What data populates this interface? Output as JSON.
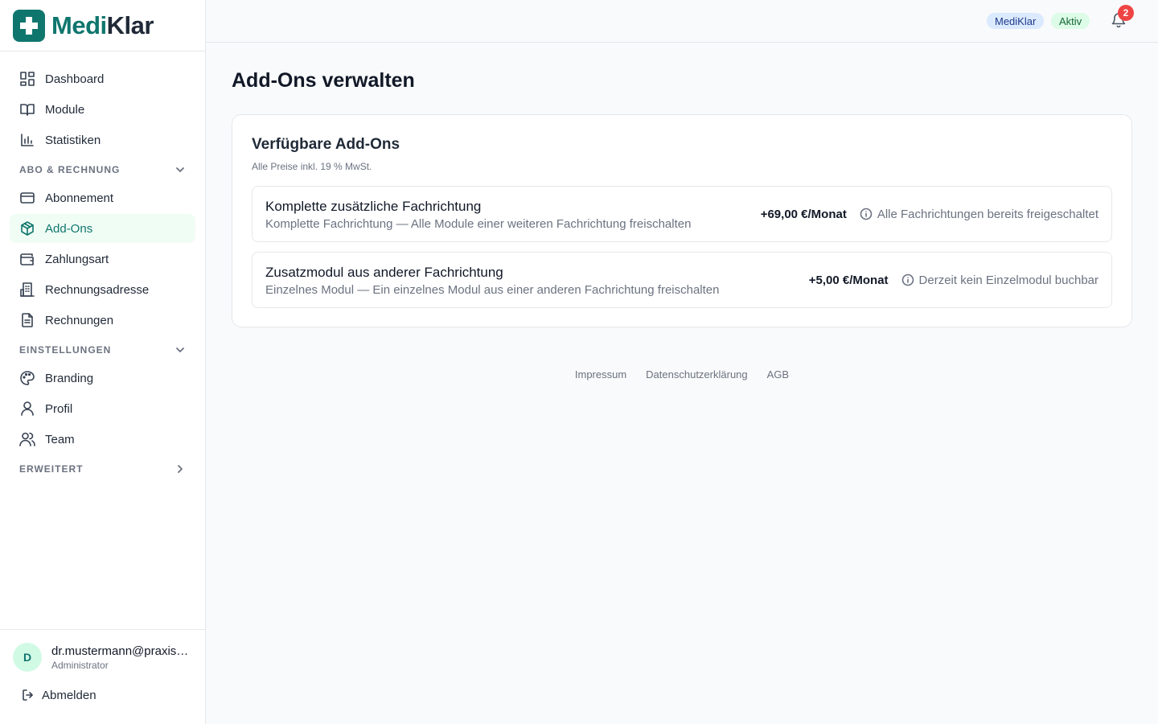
{
  "brand": {
    "name_part1": "Medi",
    "name_part2": "Klar",
    "primary_color": "#0f766e"
  },
  "sidebar": {
    "items": [
      {
        "label": "Dashboard",
        "icon": "dashboard-icon"
      },
      {
        "label": "Module",
        "icon": "book-icon"
      },
      {
        "label": "Statistiken",
        "icon": "bar-chart-icon"
      }
    ],
    "sections": [
      {
        "label": "ABO & RECHNUNG",
        "expanded": true,
        "items": [
          {
            "label": "Abonnement",
            "icon": "credit-card-icon"
          },
          {
            "label": "Add-Ons",
            "icon": "package-icon",
            "active": true
          },
          {
            "label": "Zahlungsart",
            "icon": "wallet-icon"
          },
          {
            "label": "Rechnungsadresse",
            "icon": "building-icon"
          },
          {
            "label": "Rechnungen",
            "icon": "document-icon"
          }
        ]
      },
      {
        "label": "EINSTELLUNGEN",
        "expanded": true,
        "items": [
          {
            "label": "Branding",
            "icon": "palette-icon"
          },
          {
            "label": "Profil",
            "icon": "user-icon"
          },
          {
            "label": "Team",
            "icon": "users-icon"
          }
        ]
      },
      {
        "label": "ERWEITERT",
        "expanded": false,
        "items": []
      }
    ]
  },
  "user": {
    "initial": "D",
    "email": "dr.mustermann@praxis-mustermann.de",
    "role": "Administrator",
    "logout_label": "Abmelden"
  },
  "topbar": {
    "brand_badge": "MediKlar",
    "status_badge": "Aktiv",
    "notification_count": "2"
  },
  "main": {
    "title": "Add-Ons verwalten",
    "card_title": "Verfügbare Add-Ons",
    "card_subtitle": "Alle Preise inkl. 19 % MwSt.",
    "addons": [
      {
        "name": "Komplette zusätzliche Fachrichtung",
        "description": "Komplette Fachrichtung — Alle Module einer weiteren Fachrichtung freischalten",
        "price": "+69,00 €/Monat",
        "status": "Alle Fachrichtungen bereits freigeschaltet"
      },
      {
        "name": "Zusatzmodul aus anderer Fachrichtung",
        "description": "Einzelnes Modul — Ein einzelnes Modul aus einer anderen Fachrichtung freischalten",
        "price": "+5,00 €/Monat",
        "status": "Derzeit kein Einzelmodul buchbar"
      }
    ]
  },
  "footer": {
    "links": [
      "Impressum",
      "Datenschutzerklärung",
      "AGB"
    ]
  }
}
